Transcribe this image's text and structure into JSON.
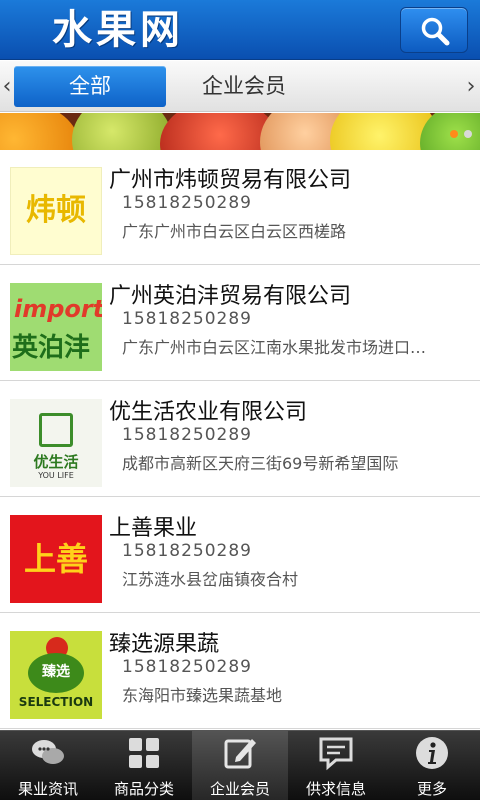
{
  "header": {
    "logo_text": "水果网",
    "search_icon": "search-icon"
  },
  "tabs": {
    "left_arrow": "‹",
    "right_arrow": "›",
    "items": [
      {
        "label": "全部",
        "active": true
      },
      {
        "label": "企业会员",
        "active": false
      }
    ]
  },
  "companies": [
    {
      "name": "广州市炜顿贸易有限公司",
      "phone": "15818250289",
      "address": "广东广州市白云区白云区西槎路",
      "logo_text": "炜顿"
    },
    {
      "name": "广州英泊沣贸易有限公司",
      "phone": "15818250289",
      "address": "广东广州市白云区江南水果批发市场进口…",
      "logo_text_top": "import",
      "logo_text_bottom": "英泊沣"
    },
    {
      "name": "优生活农业有限公司",
      "phone": "15818250289",
      "address": "成都市高新区天府三街69号新希望国际",
      "logo_text": "优生活",
      "logo_subtext": "YOU LIFE"
    },
    {
      "name": "上善果业",
      "phone": "15818250289",
      "address": "江苏涟水县岔庙镇夜合村",
      "logo_text": "上善"
    },
    {
      "name": "臻选源果蔬",
      "phone": "15818250289",
      "address": "东海阳市臻选果蔬基地",
      "logo_text": "臻选",
      "logo_subtext": "SELECTION"
    }
  ],
  "bottom_nav": [
    {
      "label": "果业资讯",
      "icon": "chat-bubbles-icon",
      "active": false
    },
    {
      "label": "商品分类",
      "icon": "grid-icon",
      "active": false
    },
    {
      "label": "企业会员",
      "icon": "edit-icon",
      "active": true
    },
    {
      "label": "供求信息",
      "icon": "message-icon",
      "active": false
    },
    {
      "label": "更多",
      "icon": "info-icon",
      "active": false
    }
  ],
  "colors": {
    "header_blue": "#0a4fb0",
    "tab_active_blue": "#1677de",
    "nav_bg": "#1a1a1a"
  }
}
